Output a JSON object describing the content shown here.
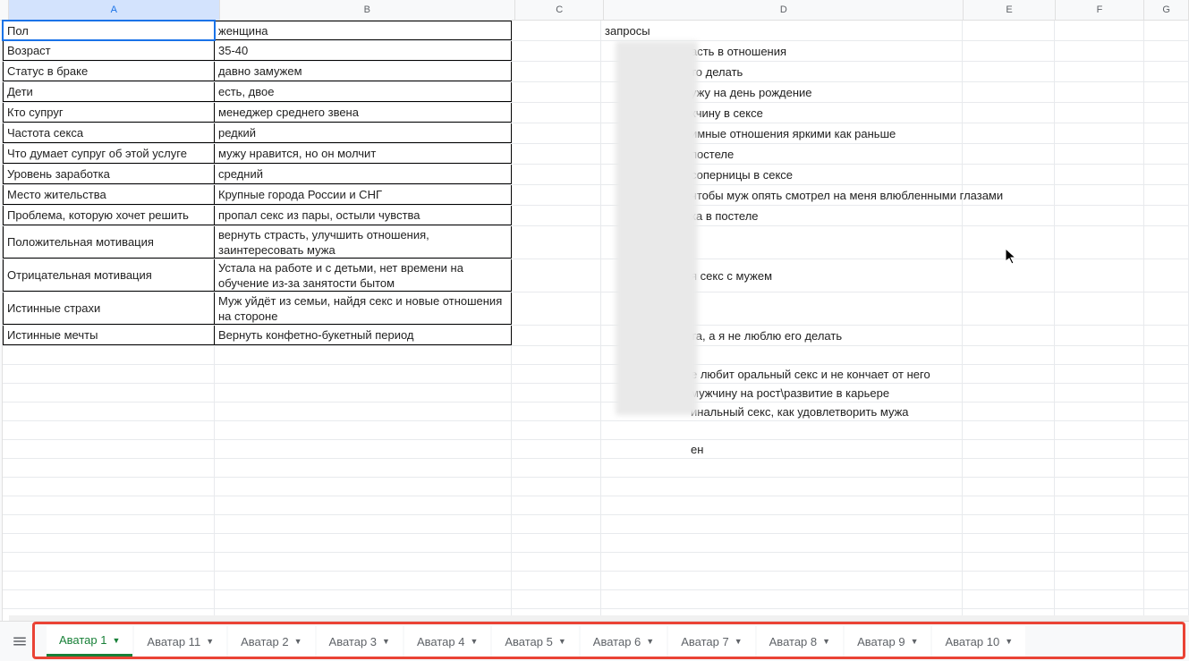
{
  "columns": [
    "A",
    "B",
    "C",
    "D",
    "E",
    "F",
    "G"
  ],
  "selectedColumn": "A",
  "tableA": [
    {
      "label": "Пол",
      "value": "женщина"
    },
    {
      "label": "Возраст",
      "value": "35-40"
    },
    {
      "label": "Статус в браке",
      "value": "давно замужем"
    },
    {
      "label": "Дети",
      "value": "есть, двое"
    },
    {
      "label": "Кто супруг",
      "value": "менеджер среднего звена"
    },
    {
      "label": "Частота секса",
      "value": "редкий"
    },
    {
      "label": "Что думает супруг об этой услуге",
      "value": "мужу нравится, но он молчит"
    },
    {
      "label": "Уровень заработка",
      "value": "средний"
    },
    {
      "label": "Место жительства",
      "value": "Крупные города России и СНГ"
    },
    {
      "label": "Проблема, которую хочет решить",
      "value": "пропал секс из пары, остыли чувства"
    },
    {
      "label": "Положительная мотивация",
      "value": "вернуть страсть, улучшить отношения, заинтересовать мужа"
    },
    {
      "label": "Отрицательная мотивация",
      "value": "Устала на работе и с детьми, нет времени на обучение из-за занятости бытом"
    },
    {
      "label": "Истинные страхи",
      "value": "Муж уйдёт из семьи, найдя секс и новые отношения на стороне"
    },
    {
      "label": "Истинные мечты",
      "value": "Вернуть конфетно-букетный период"
    }
  ],
  "columnD": {
    "header": "запросы",
    "items": [
      "асть в отношения",
      "то делать",
      "ужу на день рождение",
      "кчину в сексе",
      "имные отношения яркими как раньше",
      "постеле",
      "соперницы в сексе",
      "чтобы муж опять смотрел на меня влюбленными глазами",
      "ка в постеле",
      "",
      "я секс с мужем",
      "",
      "та, а я не люблю его делать",
      "",
      "е любит оральный секс  и не кончает от него",
      "мужчину на рост\\развитие в карьере",
      "инальный секс, как удовлетворить мужа",
      "",
      "ен"
    ]
  },
  "tabs": [
    {
      "label": "Аватар 1",
      "active": true
    },
    {
      "label": "Аватар 11",
      "active": false
    },
    {
      "label": "Аватар 2",
      "active": false
    },
    {
      "label": "Аватар 3",
      "active": false
    },
    {
      "label": "Аватар 4",
      "active": false
    },
    {
      "label": "Аватар 5",
      "active": false
    },
    {
      "label": "Аватар 6",
      "active": false
    },
    {
      "label": "Аватар 7",
      "active": false
    },
    {
      "label": "Аватар 8",
      "active": false
    },
    {
      "label": "Аватар 9",
      "active": false
    },
    {
      "label": "Аватар 10",
      "active": false
    }
  ]
}
